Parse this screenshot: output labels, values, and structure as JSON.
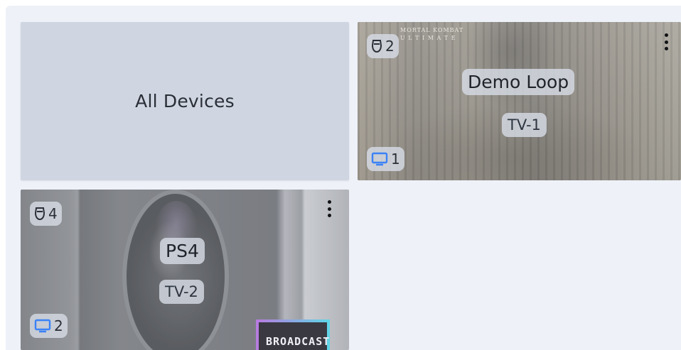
{
  "tiles": {
    "all": {
      "label": "All Devices"
    },
    "demo": {
      "logo_line1": "MORTAL KOMBAT",
      "logo_line2": "U L T I M A T E",
      "title": "Demo Loop",
      "tv_name": "TV-1",
      "controller_count": "2",
      "tv_count": "1"
    },
    "ps4": {
      "title": "PS4",
      "tv_name": "TV-2",
      "controller_count": "4",
      "tv_count": "2",
      "broadcast_text": "BROADCAST"
    }
  },
  "icons": {
    "controller": "gamepad-icon",
    "tv": "tv-icon",
    "menu": "kebab-menu-icon"
  },
  "colors": {
    "tv_icon": "#3b82f6",
    "panel_bg": "#eef1f8",
    "all_tile_bg": "#cfd6e1"
  }
}
